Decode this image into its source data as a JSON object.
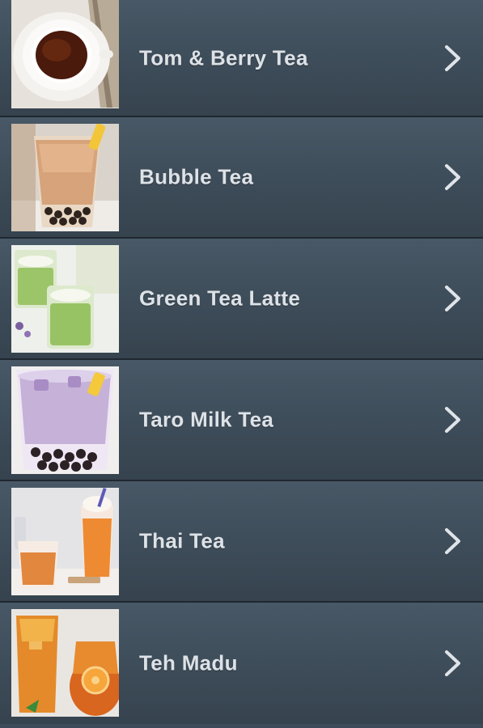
{
  "items": [
    {
      "label": "Tom & Berry Tea",
      "thumb_icon": "hot-tea-cup-icon"
    },
    {
      "label": "Bubble Tea",
      "thumb_icon": "bubble-tea-glass-icon"
    },
    {
      "label": "Green Tea Latte",
      "thumb_icon": "green-latte-glass-icon"
    },
    {
      "label": "Taro Milk Tea",
      "thumb_icon": "taro-milk-tea-glass-icon"
    },
    {
      "label": "Thai Tea",
      "thumb_icon": "thai-tea-glass-icon"
    },
    {
      "label": "Teh Madu",
      "thumb_icon": "honey-tea-glass-icon"
    }
  ],
  "chevron_icon": "chevron-right-icon",
  "colors": {
    "row_background": "#3f4e5b",
    "divider": "#1f2730",
    "label_text": "#dde2e7",
    "chevron": "#dfe4e8"
  }
}
